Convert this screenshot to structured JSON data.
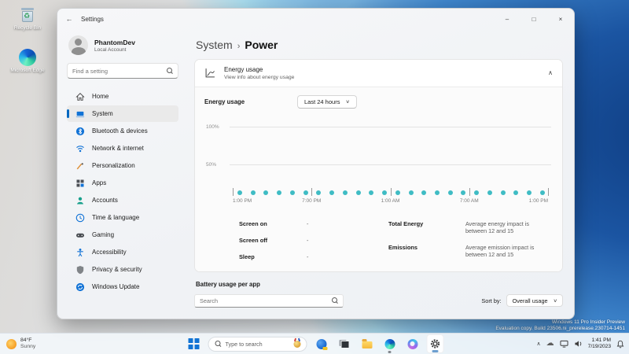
{
  "desktop": {
    "icons": [
      {
        "label": "Recycle Bin"
      },
      {
        "label": "Microsoft Edge"
      }
    ],
    "watermark": {
      "line1": "Windows 11 Pro Insider Preview",
      "line2": "Evaluation copy. Build 23506.ni_prerelease.230714-1451"
    }
  },
  "glyphs": {
    "back_arrow": "←",
    "minimize": "–",
    "maximize": "□",
    "close": "×",
    "chevron_up": "∧",
    "chevron_down": "∨",
    "recycle": "♻"
  },
  "window": {
    "title": "Settings",
    "user": {
      "name": "PhantomDev",
      "account_type": "Local Account"
    },
    "sidebar": {
      "search_placeholder": "Find a setting",
      "items": [
        {
          "label": "Home",
          "icon": "home-icon",
          "selected": false
        },
        {
          "label": "System",
          "icon": "system-icon",
          "selected": true
        },
        {
          "label": "Bluetooth & devices",
          "icon": "bluetooth-icon",
          "selected": false
        },
        {
          "label": "Network & internet",
          "icon": "network-icon",
          "selected": false
        },
        {
          "label": "Personalization",
          "icon": "personalization-icon",
          "selected": false
        },
        {
          "label": "Apps",
          "icon": "apps-icon",
          "selected": false
        },
        {
          "label": "Accounts",
          "icon": "accounts-icon",
          "selected": false
        },
        {
          "label": "Time & language",
          "icon": "time-language-icon",
          "selected": false
        },
        {
          "label": "Gaming",
          "icon": "gaming-icon",
          "selected": false
        },
        {
          "label": "Accessibility",
          "icon": "accessibility-icon",
          "selected": false
        },
        {
          "label": "Privacy & security",
          "icon": "privacy-security-icon",
          "selected": false
        },
        {
          "label": "Windows Update",
          "icon": "windows-update-icon",
          "selected": false
        }
      ]
    },
    "breadcrumb": {
      "parent": "System",
      "separator": "›",
      "current": "Power"
    },
    "energy_card": {
      "title": "Energy usage",
      "subtitle": "View info about energy usage",
      "range_label": "Energy usage",
      "range_value": "Last 24 hours",
      "summary_left": [
        {
          "label": "Screen on",
          "value": "-"
        },
        {
          "label": "Screen off",
          "value": "-"
        },
        {
          "label": "Sleep",
          "value": "-"
        }
      ],
      "summary_right": [
        {
          "label": "Total Energy",
          "value": "Average energy impact is between 12 and 15"
        },
        {
          "label": "Emissions",
          "value": "Average emission impact is between 12 and 15"
        }
      ]
    },
    "battery_section": {
      "title": "Battery usage per app",
      "search_placeholder": "Search",
      "sort_label": "Sort by:",
      "sort_value": "Overall usage"
    }
  },
  "chart_data": {
    "type": "scatter",
    "title": "Energy usage, last 24 hours",
    "x_tick_labels": [
      "1:00 PM",
      "7:00 PM",
      "1:00 AM",
      "7:00 AM",
      "1:00 PM"
    ],
    "y_tick_labels": [
      "100%",
      "50%"
    ],
    "ylim": [
      0,
      100
    ],
    "values": [
      0,
      0,
      0,
      0,
      0,
      0,
      0,
      0,
      0,
      0,
      0,
      0,
      0,
      0,
      0,
      0,
      0,
      0,
      0,
      0,
      0,
      0,
      0,
      0
    ],
    "note": "24 hourly energy-usage dots, all at ~0% along the baseline",
    "dot_color": "#3fbcc4",
    "grid": true
  },
  "taskbar": {
    "weather": {
      "temp": "84°F",
      "condition": "Sunny"
    },
    "search_placeholder": "Type to search",
    "clock": {
      "time": "1:41 PM",
      "date": "7/19/2023"
    }
  },
  "colors": {
    "accent": "#0067c0",
    "dot": "#3fbcc4"
  }
}
